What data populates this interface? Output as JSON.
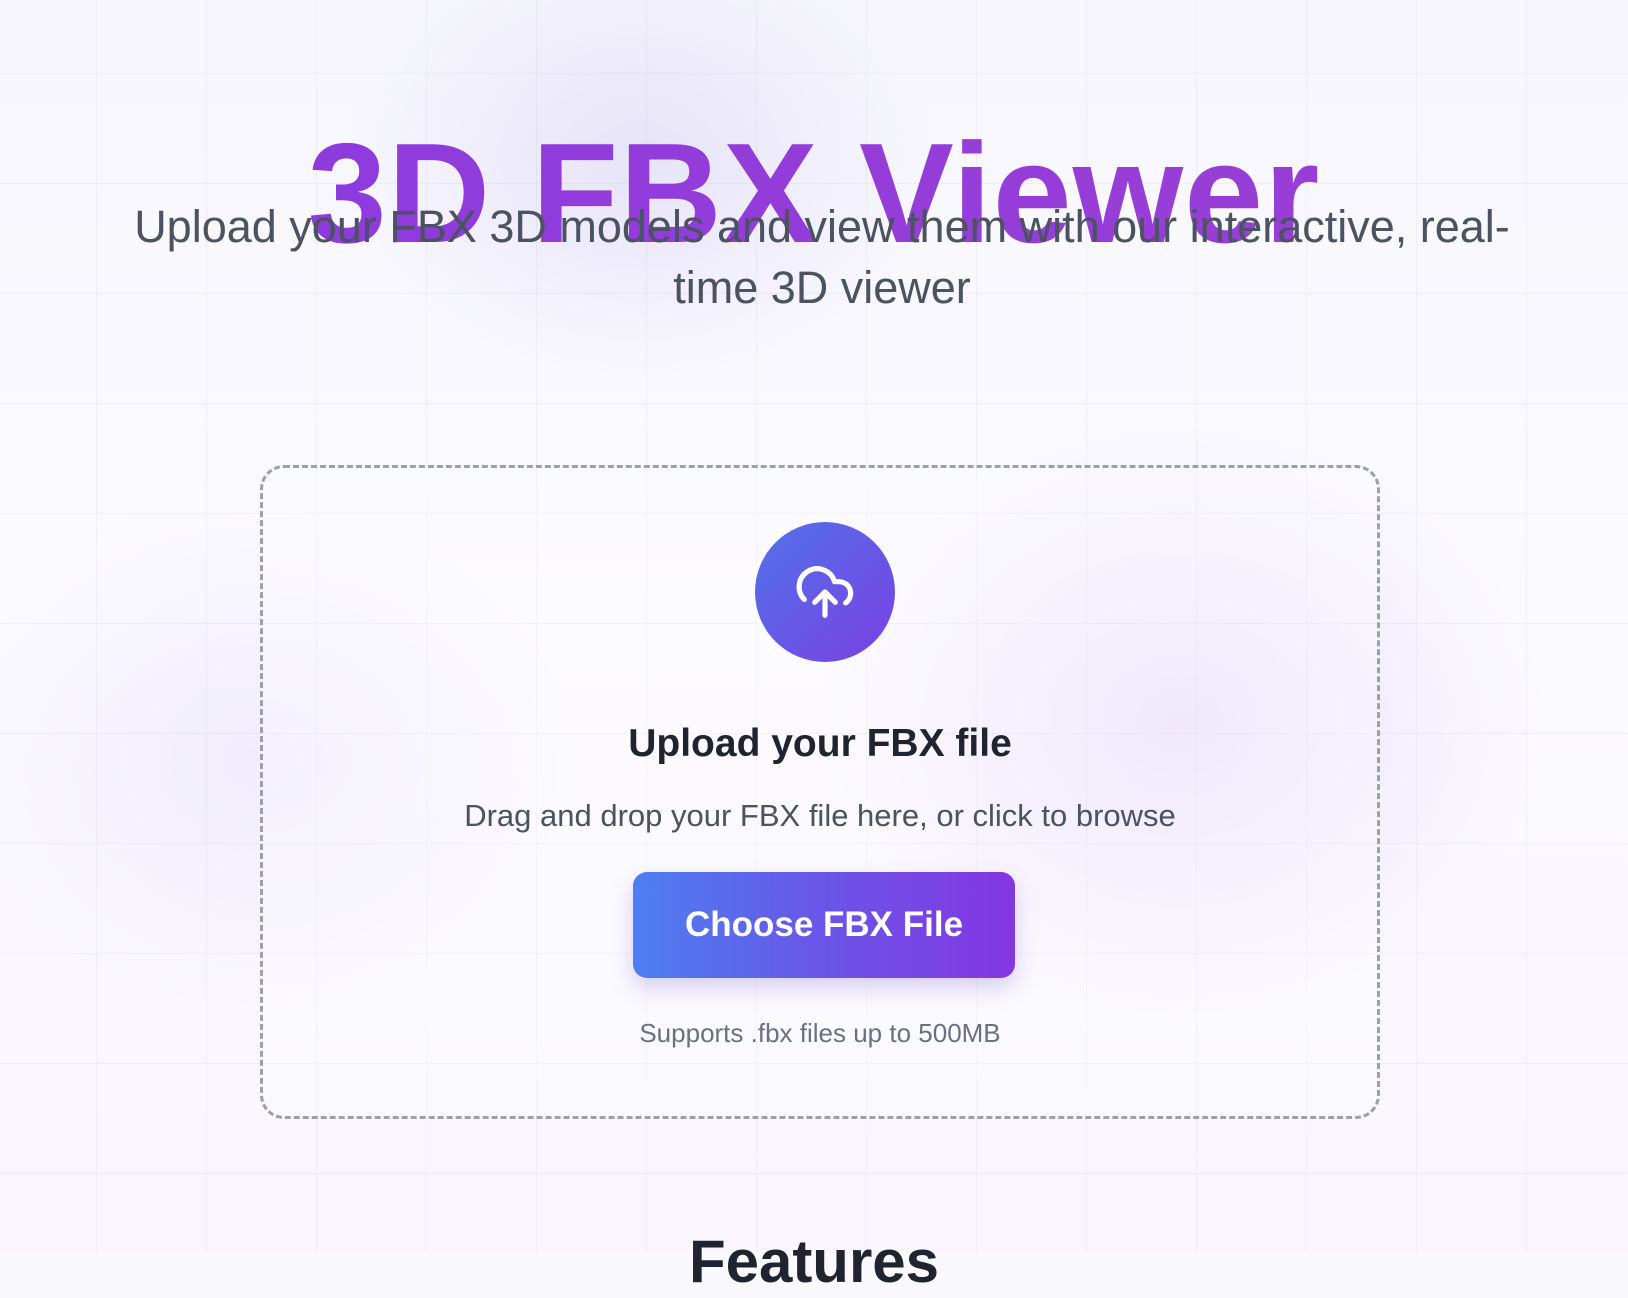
{
  "hero": {
    "title": "3D FBX Viewer",
    "subtitle": "Upload your FBX 3D models and view them with our interactive, real-time 3D viewer"
  },
  "upload": {
    "icon": "cloud-upload-icon",
    "title": "Upload your FBX file",
    "description": "Drag and drop your FBX file here, or click to browse",
    "button_label": "Choose FBX File",
    "support_note": "Supports .fbx files up to 500MB"
  },
  "features": {
    "heading": "Features"
  },
  "colors": {
    "title_gradient_start": "#8b3ae0",
    "title_gradient_end": "#9b3fd3",
    "button_gradient_start": "#4d7ff0",
    "button_gradient_end": "#8436e2",
    "icon_circle_start": "#5172ea",
    "icon_circle_end": "#7a40e2"
  }
}
